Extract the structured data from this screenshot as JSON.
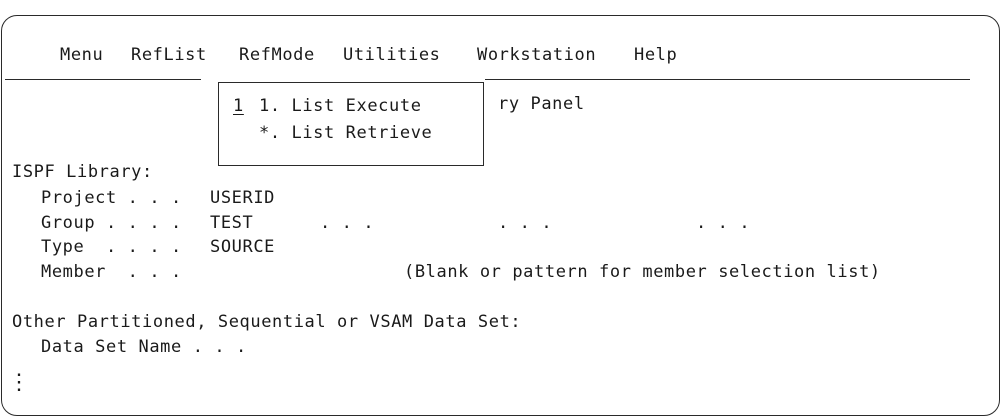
{
  "menu_bar": {
    "items": [
      "Menu",
      "RefList",
      "RefMode",
      "Utilities",
      "Workstation",
      "Help"
    ]
  },
  "popup": {
    "input_value": "1",
    "options": [
      "1. List Execute",
      "*. List Retrieve"
    ]
  },
  "panel": {
    "title_fragment": "ry Panel",
    "library_label": "ISPF Library:",
    "project_label": "Project . . .",
    "project_value": "USERID",
    "group_label": "Group . . . .",
    "group_value": "TEST",
    "group_sep1": ". . .",
    "group_sep2": ". . .",
    "group_sep3": ". . .",
    "type_label": "Type  . . . .",
    "type_value": "SOURCE",
    "member_label": "Member  . . .",
    "member_hint": "(Blank or pattern for member selection list)",
    "other_label": "Other Partitioned, Sequential or VSAM Data Set:",
    "dsname_label": "Data Set Name . . ."
  },
  "continuation_marker": "⋮"
}
